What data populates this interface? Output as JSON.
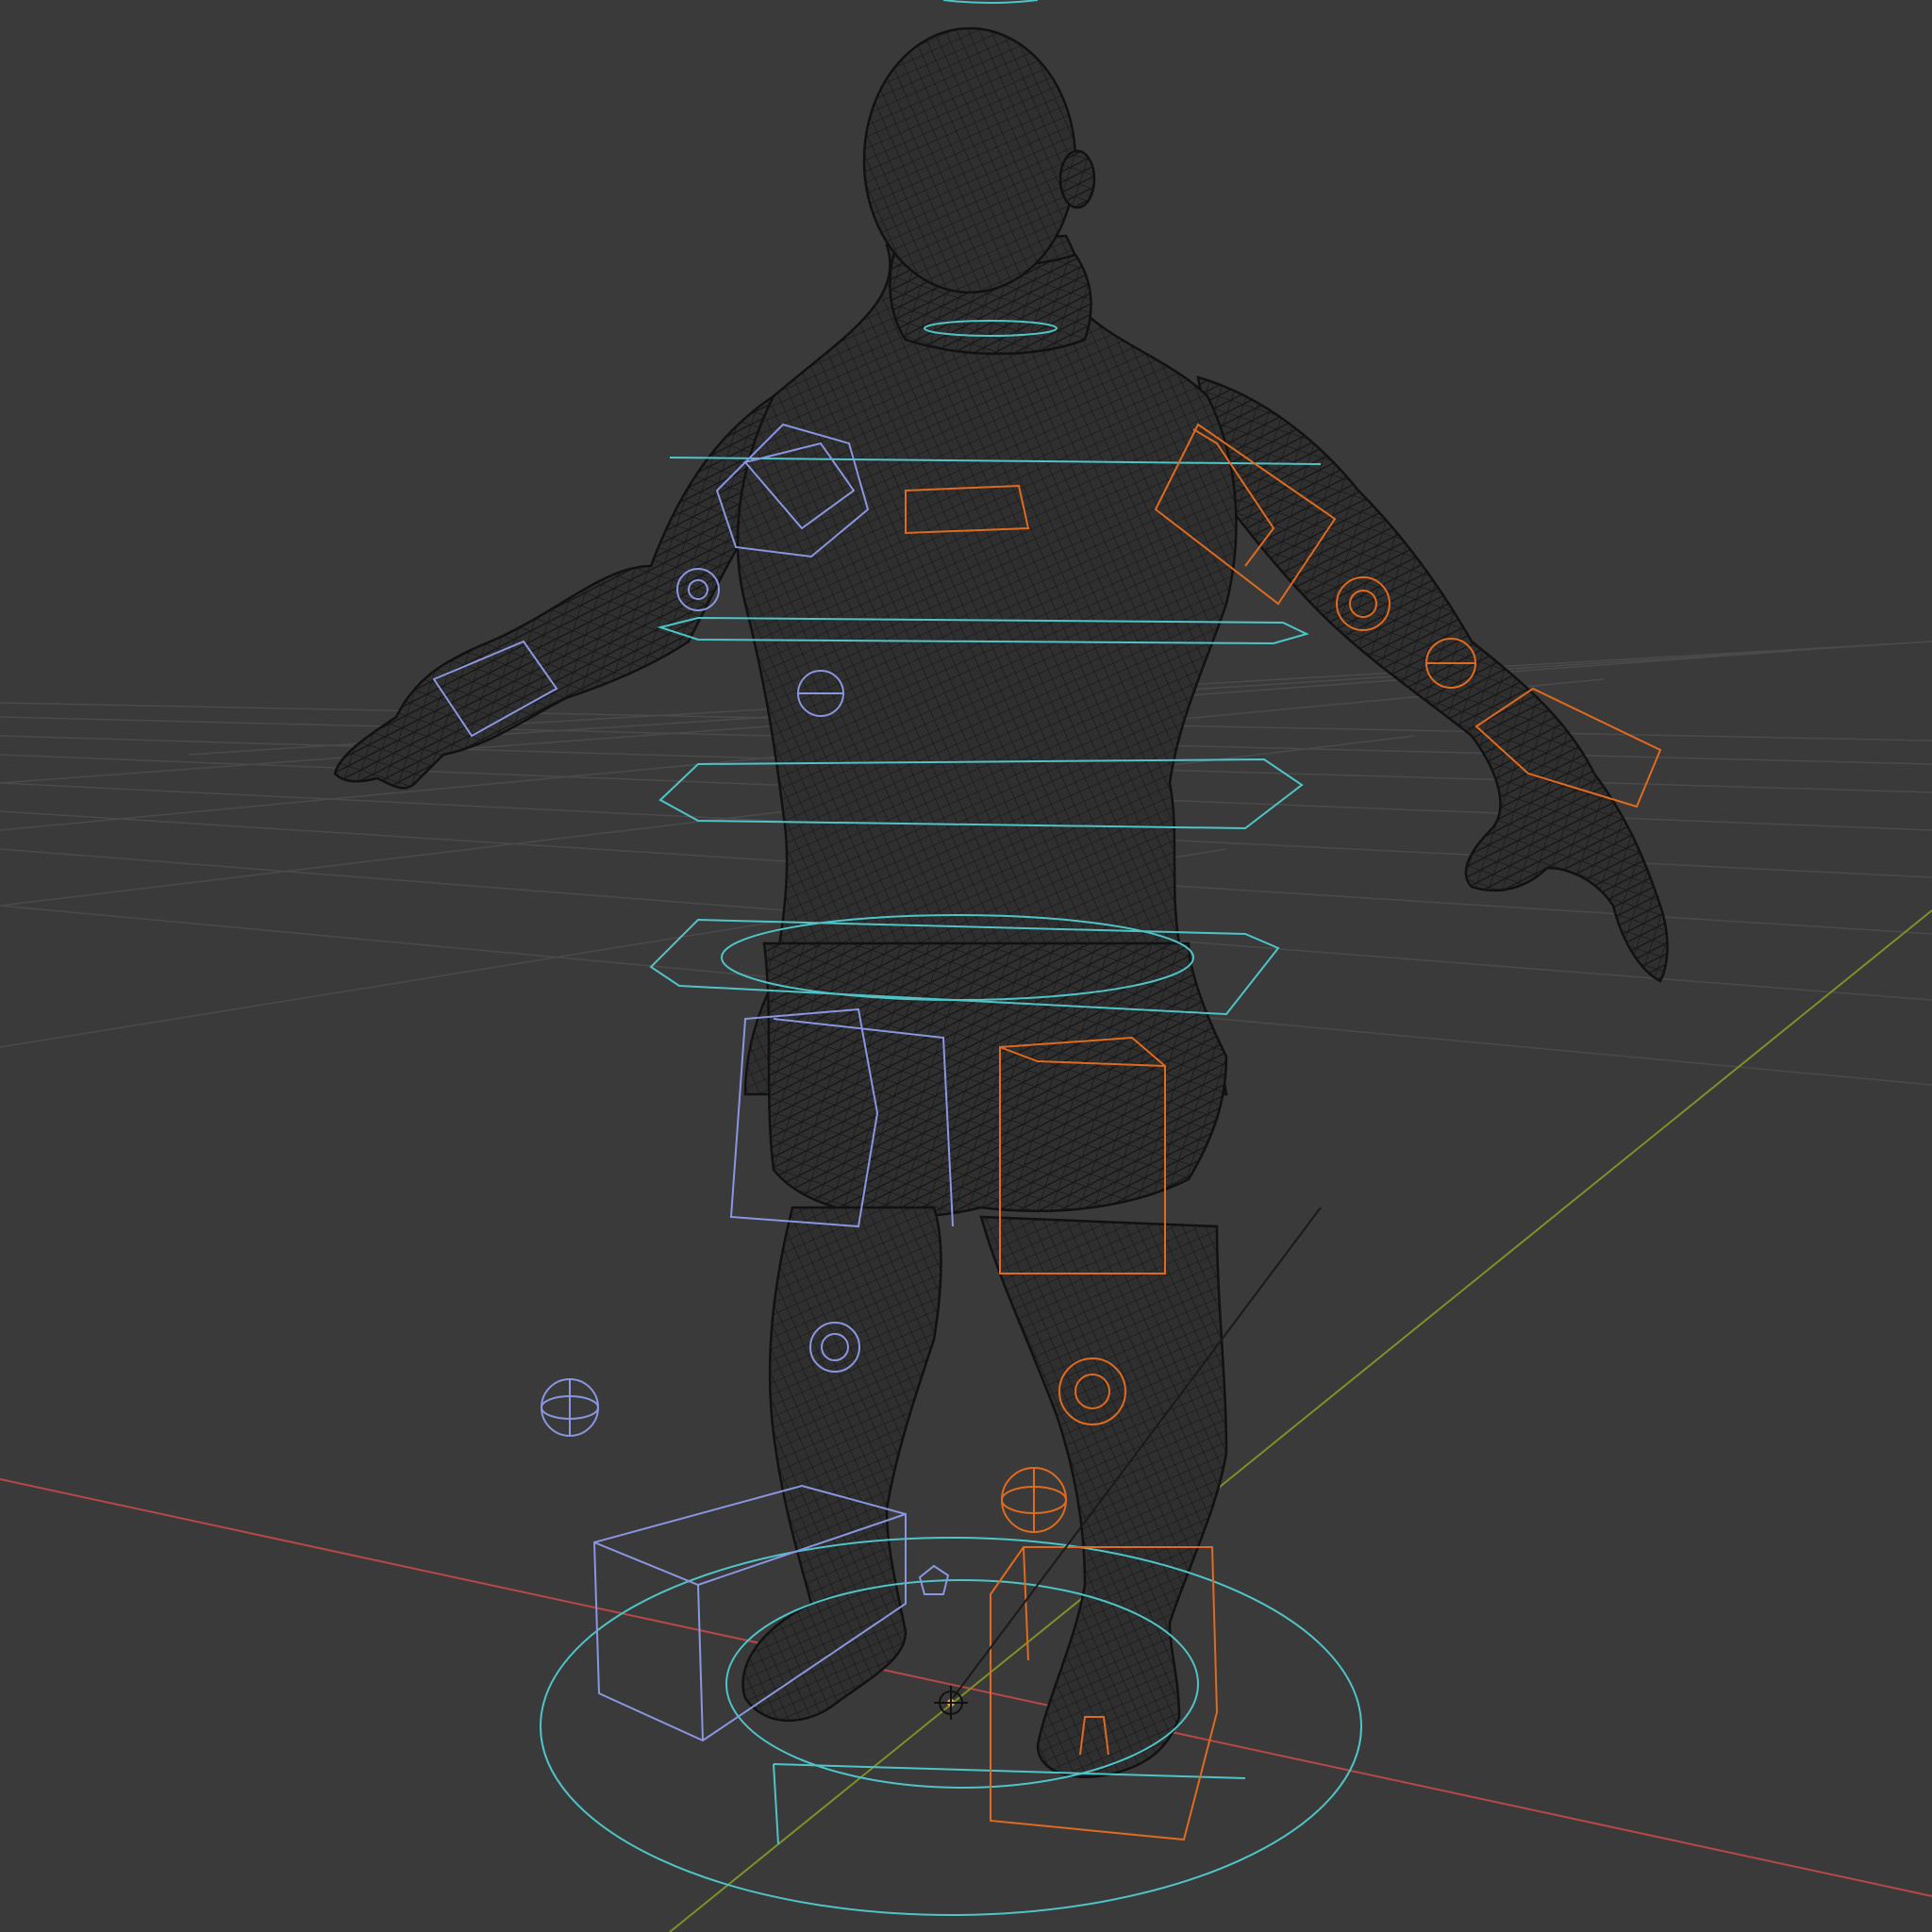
{
  "viewport": {
    "shading_mode": "wireframe",
    "background_color": "#3a3a3a",
    "grid_color": "#4a4a4a",
    "axis_x_color": "#b84848",
    "axis_y_color": "#7c9128",
    "mesh_wire_color": "#141414",
    "mesh_fill_color": "#2f2f2f",
    "bone_left_color": "#8a96e0",
    "bone_right_color": "#e06a1e",
    "control_color": "#4fc4c8",
    "origin_icon": "origin-cursor-icon"
  },
  "scene": {
    "object": "character-mesh",
    "pose": "A-pose",
    "rig_overlay": true
  }
}
